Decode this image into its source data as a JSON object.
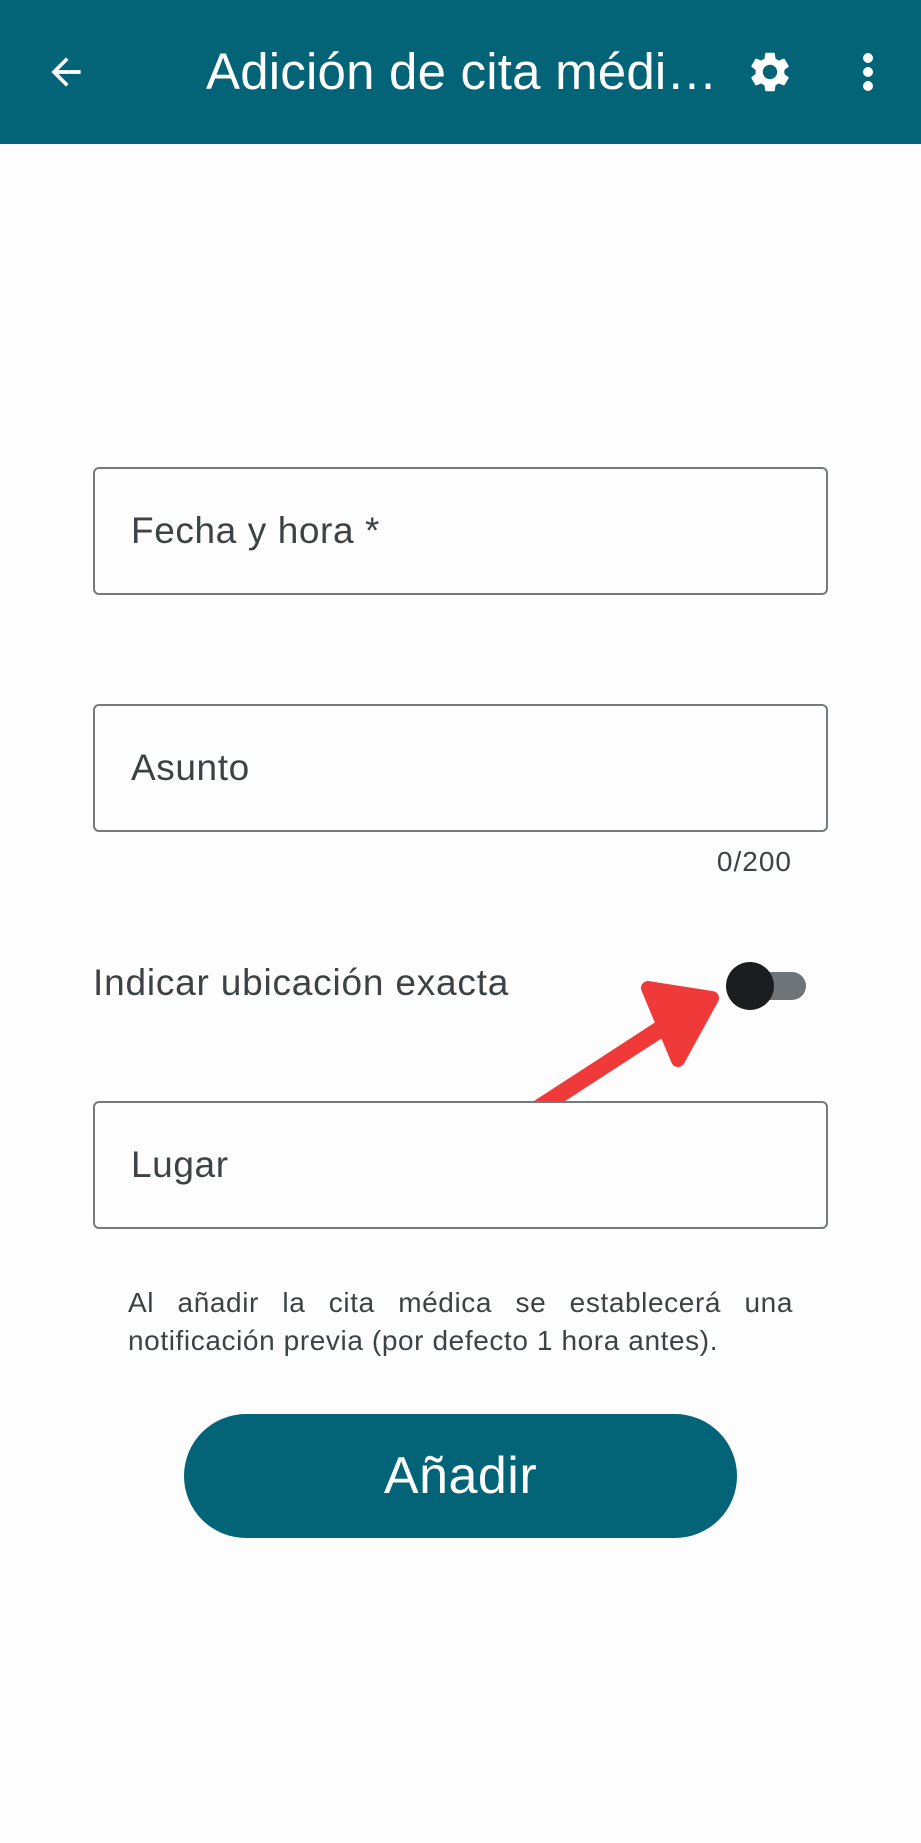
{
  "appbar": {
    "back_icon": "arrow-left-icon",
    "title": "Adición de cita médi…",
    "settings_icon": "gear-icon",
    "menu_icon": "more-vertical-icon",
    "background_color": "#036477"
  },
  "form": {
    "date_time": {
      "placeholder": "Fecha y hora *",
      "value": ""
    },
    "subject": {
      "placeholder": "Asunto",
      "value": "",
      "counter": "0/200"
    },
    "exact_location_toggle": {
      "label": "Indicar ubicación exacta",
      "checked": false
    },
    "place": {
      "placeholder": "Lugar",
      "value": ""
    },
    "notice": "Al añadir la cita médica se establecerá una notificación previa (por defecto 1 hora antes).",
    "add_button_label": "Añadir"
  },
  "annotation": {
    "icon": "red-arrow-icon",
    "color": "#f03a3a"
  }
}
